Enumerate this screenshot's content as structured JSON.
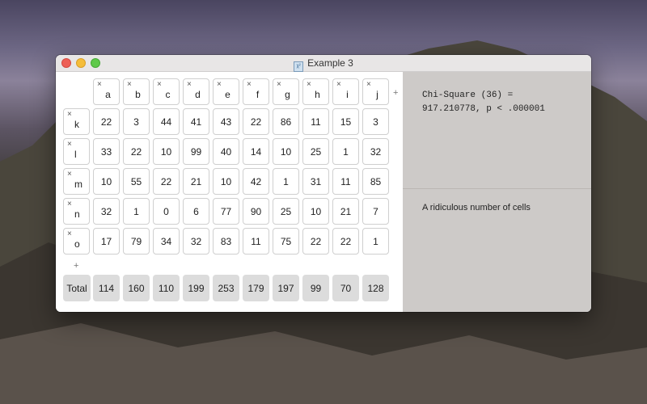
{
  "window": {
    "title": "Example 3"
  },
  "columns": [
    "a",
    "b",
    "c",
    "d",
    "e",
    "f",
    "g",
    "h",
    "i",
    "j"
  ],
  "rows": [
    {
      "label": "k",
      "values": [
        "22",
        "3",
        "44",
        "41",
        "43",
        "22",
        "86",
        "11",
        "15",
        "3"
      ]
    },
    {
      "label": "l",
      "values": [
        "33",
        "22",
        "10",
        "99",
        "40",
        "14",
        "10",
        "25",
        "1",
        "32"
      ]
    },
    {
      "label": "m",
      "values": [
        "10",
        "55",
        "22",
        "21",
        "10",
        "42",
        "1",
        "31",
        "11",
        "85"
      ]
    },
    {
      "label": "n",
      "values": [
        "32",
        "1",
        "0",
        "6",
        "77",
        "90",
        "25",
        "10",
        "21",
        "7"
      ]
    },
    {
      "label": "o",
      "values": [
        "17",
        "79",
        "34",
        "32",
        "83",
        "11",
        "75",
        "22",
        "22",
        "1"
      ]
    }
  ],
  "totals": {
    "label": "Total",
    "values": [
      "114",
      "160",
      "110",
      "199",
      "253",
      "179",
      "197",
      "99",
      "70",
      "128"
    ]
  },
  "add_symbol": "+",
  "remove_symbol": "×",
  "result": {
    "line1": "Chi-Square (36) =",
    "line2": "917.210778, p < .000001"
  },
  "notes": "A ridiculous number of cells"
}
